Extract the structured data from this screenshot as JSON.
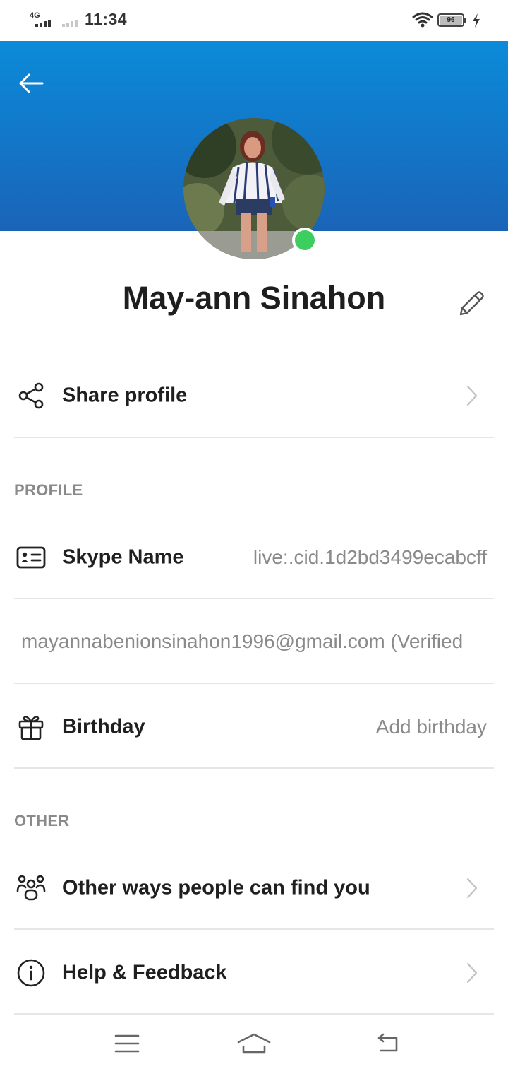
{
  "status_bar": {
    "network": "4G",
    "time": "11:34",
    "battery": "96"
  },
  "profile": {
    "name": "May-ann Sinahon"
  },
  "share_row": {
    "label": "Share profile"
  },
  "profile_section": {
    "header": "PROFILE",
    "skype_name_label": "Skype Name",
    "skype_name_value": "live:.cid.1d2bd3499ecabcff",
    "email": "mayannabenionsinahon1996@gmail.com",
    "email_status": "(Verified",
    "birthday_label": "Birthday",
    "birthday_value": "Add birthday"
  },
  "other_section": {
    "header": "OTHER",
    "find_you_label": "Other ways people can find you",
    "help_label": "Help & Feedback"
  },
  "colors": {
    "header_top": "#0b8bd9",
    "header_bottom": "#1a64b8",
    "presence": "#3ecd5f",
    "secondary_text": "#8a8a8a",
    "divider": "#e6e6e6"
  },
  "icons": {
    "back": "arrow-left-icon",
    "edit": "pencil-icon",
    "share": "share-icon",
    "skype_name": "id-card-icon",
    "birthday": "gift-icon",
    "find_you": "people-group-icon",
    "help": "info-icon",
    "chevron": "chevron-right-icon"
  }
}
